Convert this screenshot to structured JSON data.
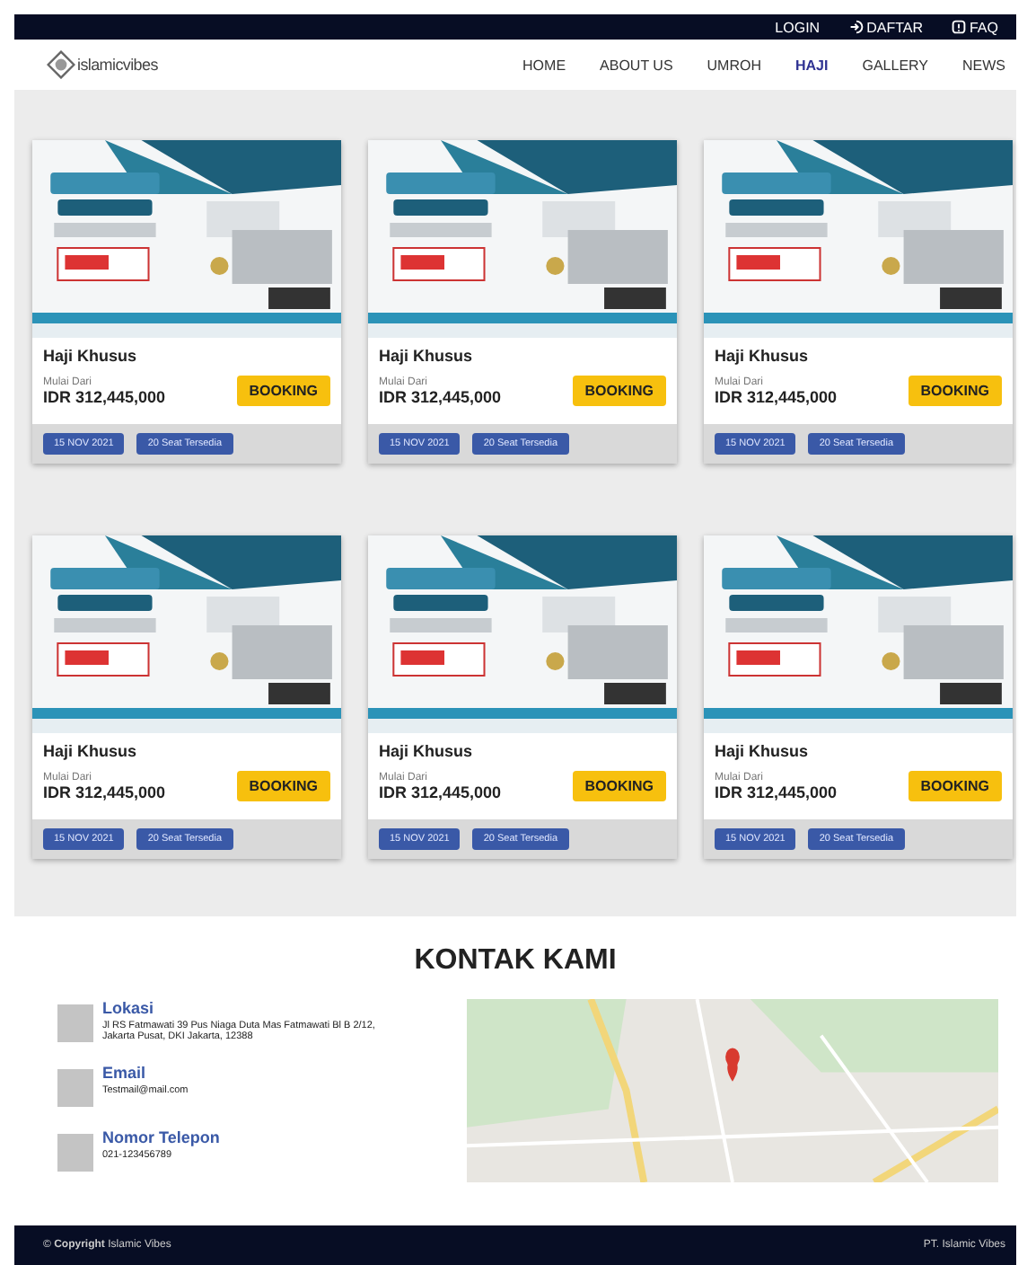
{
  "top_bar": {
    "links": [
      {
        "label": "LOGIN",
        "kind": "plain"
      },
      {
        "label": "DAFTAR",
        "kind": "login"
      },
      {
        "label": "FAQ",
        "kind": "info"
      }
    ]
  },
  "navbar": {
    "logo": "islamicvibes",
    "items": [
      {
        "label": "HOME",
        "selected": false
      },
      {
        "label": "ABOUT US",
        "selected": false
      },
      {
        "label": "UMROH",
        "selected": false
      },
      {
        "label": "HAJI",
        "selected": true
      },
      {
        "label": "GALLERY",
        "selected": false
      },
      {
        "label": "NEWS",
        "selected": false
      }
    ]
  },
  "packages": [
    {
      "title": "Haji Khusus",
      "price_label": "Mulai Dari",
      "price": "IDR 312,445,000",
      "button": "BOOKING",
      "date": "15 NOV 2021",
      "seats": "20 Seat Tersedia"
    },
    {
      "title": "Haji Khusus",
      "price_label": "Mulai Dari",
      "price": "IDR 312,445,000",
      "button": "BOOKING",
      "date": "15 NOV 2021",
      "seats": "20 Seat Tersedia"
    },
    {
      "title": "Haji Khusus",
      "price_label": "Mulai Dari",
      "price": "IDR 312,445,000",
      "button": "BOOKING",
      "date": "15 NOV 2021",
      "seats": "20 Seat Tersedia"
    },
    {
      "title": "Haji Khusus",
      "price_label": "Mulai Dari",
      "price": "IDR 312,445,000",
      "button": "BOOKING",
      "date": "15 NOV 2021",
      "seats": "20 Seat Tersedia"
    },
    {
      "title": "Haji Khusus",
      "price_label": "Mulai Dari",
      "price": "IDR 312,445,000",
      "button": "BOOKING",
      "date": "15 NOV 2021",
      "seats": "20 Seat Tersedia"
    },
    {
      "title": "Haji Khusus",
      "price_label": "Mulai Dari",
      "price": "IDR 312,445,000",
      "button": "BOOKING",
      "date": "15 NOV 2021",
      "seats": "20 Seat Tersedia"
    }
  ],
  "contact": {
    "title": "KONTAK KAMI",
    "items": [
      {
        "heading": "Lokasi",
        "text": "Jl RS Fatmawati 39 Pus Niaga Duta Mas Fatmawati Bl B 2/12, Jakarta Pusat, DKI Jakarta, 12388"
      },
      {
        "heading": "Email",
        "text": "Testmail@mail.com"
      },
      {
        "heading": "Nomor Telepon",
        "text": "021-123456789"
      }
    ]
  },
  "footer": {
    "copyright": "© **Copyright** Islamic Vibes",
    "company": "PT. Islamic Vibes"
  }
}
